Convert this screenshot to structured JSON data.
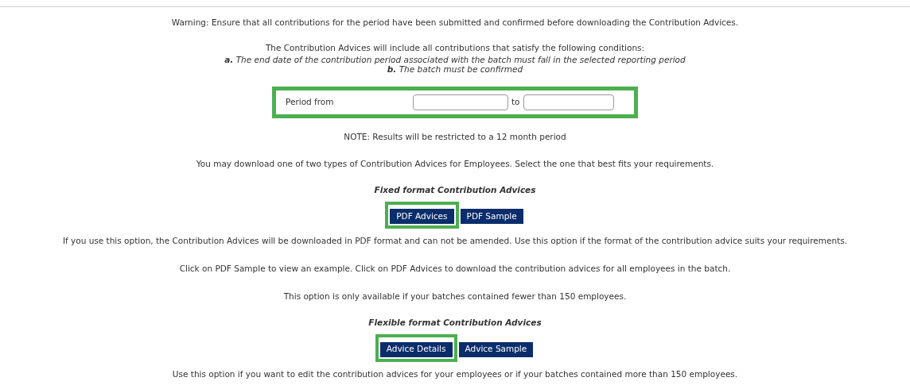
{
  "warning": "Warning: Ensure that all contributions for the period have been submitted and confirmed before downloading the Contribution Advices.",
  "conditions": {
    "intro": "The Contribution Advices will include all contributions that satisfy the following conditions:",
    "items": [
      {
        "marker": "a.",
        "text": "The end date of the contribution period associated with the batch must fall in the selected reporting period"
      },
      {
        "marker": "b.",
        "text": "The batch must be confirmed"
      }
    ]
  },
  "period": {
    "label": "Period from",
    "separator": "to",
    "highlighted": true
  },
  "note": "NOTE: Results will be restricted to a 12 month period",
  "intro": "You may download one of two types of Contribution Advices for Employees. Select the one that best fits your requirements.",
  "sections": [
    {
      "heading": "Fixed format Contribution Advices",
      "buttons": [
        {
          "label": "PDF Advices",
          "highlighted": true
        },
        {
          "label": "PDF Sample",
          "highlighted": false
        }
      ],
      "paragraphs": [
        "If you use this option, the Contribution Advices will be downloaded in PDF format and can not be amended. Use this option if the format of the contribution advice suits your requirements.",
        "Click on PDF Sample to view an example. Click on PDF Advices to download the contribution advices for all employees in the batch.",
        "This option is only available if your batches contained fewer than 150 employees."
      ]
    },
    {
      "heading": "Flexible format Contribution Advices",
      "buttons": [
        {
          "label": "Advice Details",
          "highlighted": true
        },
        {
          "label": "Advice Sample",
          "highlighted": false
        }
      ],
      "paragraphs": [
        "Use this option if you want to edit the contribution advices for your employees or if your batches contained more than 150 employees."
      ]
    }
  ]
}
